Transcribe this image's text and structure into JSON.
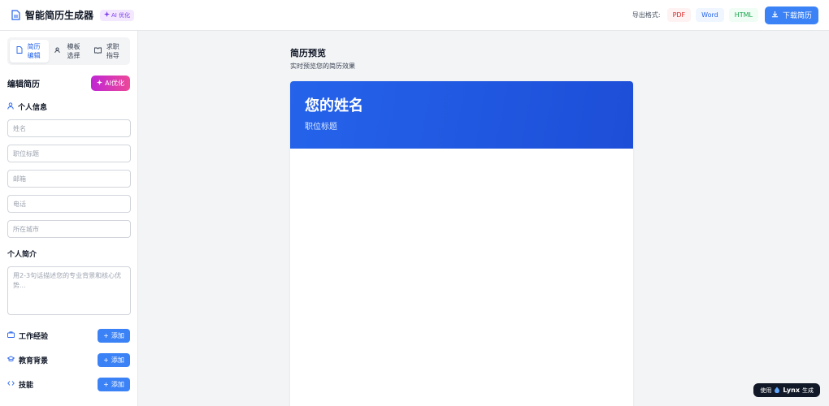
{
  "header": {
    "title": "智能简历生成器",
    "ai_badge": "AI 优化",
    "export_label": "导出格式:",
    "formats": {
      "pdf": "PDF",
      "word": "Word",
      "html": "HTML"
    },
    "download_label": "下载简历",
    "icons": {
      "logo": "document-icon",
      "ai": "sparkle-icon",
      "download": "download-icon"
    }
  },
  "sidebar": {
    "tabs": [
      {
        "label": "简历编辑",
        "icon": "document-icon",
        "active": true
      },
      {
        "label": "模板选择",
        "icon": "users-icon",
        "active": false
      },
      {
        "label": "求职指导",
        "icon": "book-icon",
        "active": false
      }
    ],
    "edit_title": "编辑简历",
    "ai_button": "AI优化",
    "personal_section": "个人信息",
    "fields": {
      "name_placeholder": "姓名",
      "job_placeholder": "职位标题",
      "email_placeholder": "邮箱",
      "phone_placeholder": "电话",
      "city_placeholder": "所在城市"
    },
    "summary_section": "个人简介",
    "summary_placeholder": "用2-3句话描述您的专业背景和核心优势...",
    "sections": {
      "work": "工作经验",
      "education": "教育背景",
      "skills": "技能"
    },
    "add_label": "添加"
  },
  "main": {
    "preview_title": "简历预览",
    "preview_subtitle": "实时预览您的简历效果",
    "resume_name": "您的姓名",
    "resume_job": "职位标题"
  },
  "badge": {
    "prefix": "使用",
    "brand": "Lynx",
    "suffix": "生成"
  },
  "colors": {
    "accent": "#3b82f6",
    "header_gradient_start": "#2563eb",
    "header_gradient_end": "#1d4ed8",
    "ai_gradient_start": "#c026d3",
    "ai_gradient_end": "#ec4899"
  }
}
